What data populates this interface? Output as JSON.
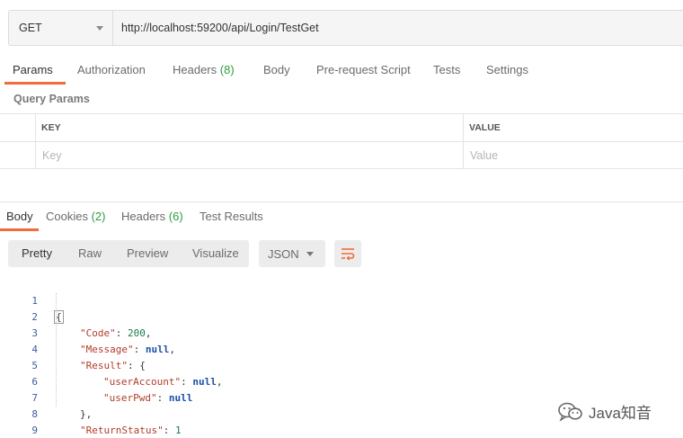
{
  "request": {
    "method": "GET",
    "url": "http://localhost:59200/api/Login/TestGet"
  },
  "request_tabs": [
    {
      "label": "Params",
      "count": ""
    },
    {
      "label": "Authorization",
      "count": ""
    },
    {
      "label": "Headers",
      "count": "(8)"
    },
    {
      "label": "Body",
      "count": ""
    },
    {
      "label": "Pre-request Script",
      "count": ""
    },
    {
      "label": "Tests",
      "count": ""
    },
    {
      "label": "Settings",
      "count": ""
    }
  ],
  "query_params": {
    "title": "Query Params",
    "key_header": "KEY",
    "value_header": "VALUE",
    "key_placeholder": "Key",
    "value_placeholder": "Value"
  },
  "response_tabs": [
    {
      "label": "Body",
      "count": ""
    },
    {
      "label": "Cookies",
      "count": "(2)"
    },
    {
      "label": "Headers",
      "count": "(6)"
    },
    {
      "label": "Test Results",
      "count": ""
    }
  ],
  "format_toolbar": {
    "options": [
      "Pretty",
      "Raw",
      "Preview",
      "Visualize"
    ],
    "language": "JSON"
  },
  "response_body": {
    "line_numbers": [
      "1",
      "2",
      "3",
      "4",
      "5",
      "6",
      "7",
      "8",
      "9"
    ],
    "open_brace": "{",
    "code_key": "\"Code\"",
    "code_value": "200",
    "message_key": "\"Message\"",
    "message_value": "null",
    "result_key": "\"Result\"",
    "user_account_key": "\"userAccount\"",
    "user_account_value": "null",
    "user_pwd_key": "\"userPwd\"",
    "user_pwd_value": "null",
    "inner_close": "},",
    "return_status_key": "\"ReturnStatus\"",
    "return_status_value": "1",
    "close_brace": "}"
  },
  "watermark": {
    "text": "Java知音"
  },
  "colors": {
    "accent": "#f26b3a",
    "count_green": "#2e9d3b",
    "json_key": "#b33d2a",
    "json_number": "#1b7a4a",
    "json_null": "#1b4fa8",
    "line_number": "#3a5f9c"
  }
}
